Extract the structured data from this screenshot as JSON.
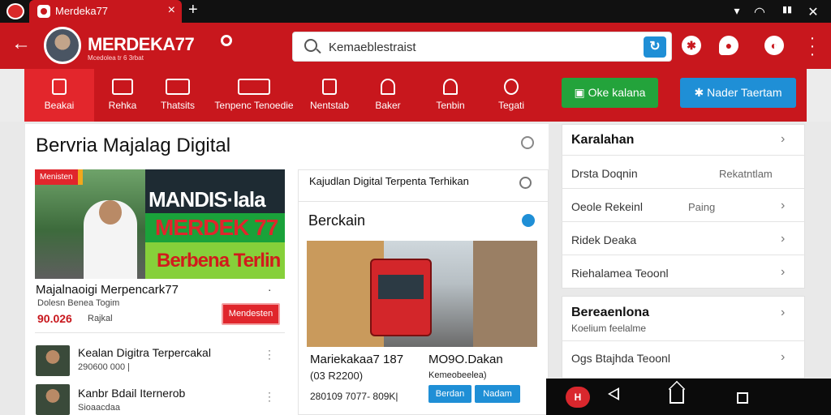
{
  "tab": {
    "title": "Merdeka77",
    "close": "×",
    "new_tab": "+"
  },
  "status_icons": [
    "▾",
    "▮▮",
    "✕"
  ],
  "header": {
    "back": "←",
    "brand": "MERDEKA77",
    "brand_sub": "Mcedolea tr 6 3rbat",
    "search_text": "Kemaeblestraist"
  },
  "nav": {
    "items": [
      "Beakai",
      "Rehka",
      "Thatsits",
      "Tenpenc Tenoedie",
      "Nentstab",
      "Baker",
      "Tenbin",
      "Tegati"
    ],
    "cta_green": "Oke kalana",
    "cta_blue": "Nader Taertam"
  },
  "main": {
    "section_title": "Bervria Majalag Digital",
    "hero": {
      "badge": "Menisten",
      "line1": "MANDIS·lala",
      "line2": "MERDEK 77",
      "line3": "Berbena Terlin"
    },
    "featured": {
      "title": "Majalnaoigi Merpencark77",
      "subtitle": "Dolesn Benea Togim",
      "price": "90.026",
      "price_sub": "Rajkal",
      "button": "Mendesten"
    },
    "list": [
      {
        "title": "Kealan Digitra Terpercakal",
        "subtitle": "290600 000 |"
      },
      {
        "title": "Kanbr Bdail Iternerob",
        "subtitle": "Sioaacdaa"
      }
    ]
  },
  "middle": {
    "header": "Kajudlan Digital Terpenta Terhikan",
    "section": "Berckain",
    "caption_left_1": "Mariekakaa7 187",
    "caption_left_2": "(03 R2200)",
    "caption_right_1": "MO9O.Dakan",
    "caption_right_2": "Kemeobeelea)",
    "price": "280109 7077- 809K|",
    "btn1": "Berdan",
    "btn2": "Nadam"
  },
  "side": {
    "section1_title": "Karalahan",
    "rows1": [
      {
        "label": "Drsta Doqnin",
        "value": "Rekatntlam"
      },
      {
        "label": "Oeole Rekeinl",
        "value": "Paing"
      },
      {
        "label": "Ridek Deaka",
        "value": ""
      },
      {
        "label": "Riehalamea Teoonl",
        "value": ""
      }
    ],
    "section2_title": "Bereaenlona",
    "section2_sub": "Koelium feelalme",
    "rows2": [
      {
        "label": "Ogs Btajhda Teoonl",
        "value": ""
      }
    ]
  },
  "android": {
    "app": "H"
  }
}
